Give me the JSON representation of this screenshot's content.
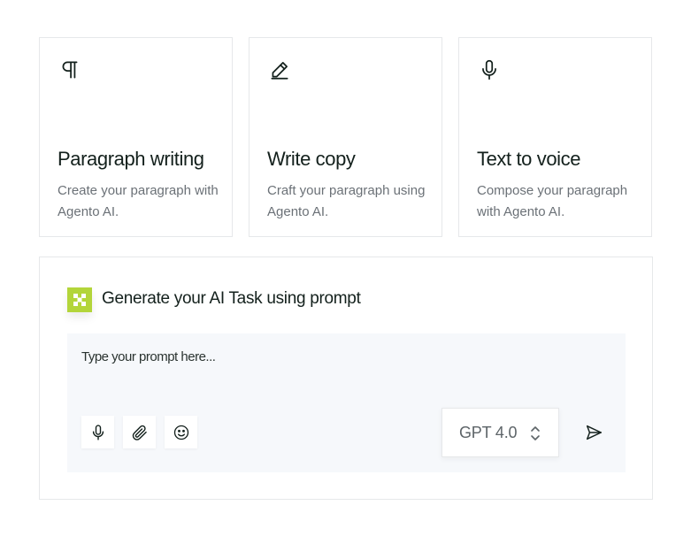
{
  "cards": [
    {
      "icon": "paragraph-icon",
      "title": "Paragraph writing",
      "description": "Create your paragraph with Agento AI."
    },
    {
      "icon": "pencil-icon",
      "title": "Write copy",
      "description": "Craft your paragraph using Agento AI."
    },
    {
      "icon": "microphone-icon",
      "title": "Text to voice",
      "description": "Compose your paragraph with Agento AI."
    }
  ],
  "prompt": {
    "logo_icon": "agento-logo-icon",
    "heading": "Generate your AI Task using prompt",
    "placeholder": "Type your prompt here...",
    "value": "",
    "tools": [
      "microphone-icon",
      "paperclip-icon",
      "smiley-icon"
    ],
    "model": "GPT 4.0",
    "model_icon": "chevron-up-down-icon",
    "send_icon": "send-icon"
  },
  "colors": {
    "accent": "#b3d53a",
    "heading_text": "#13201c",
    "muted_text": "#6b7177",
    "border": "#e6e8ea",
    "prompt_background": "#f6f8fb"
  }
}
